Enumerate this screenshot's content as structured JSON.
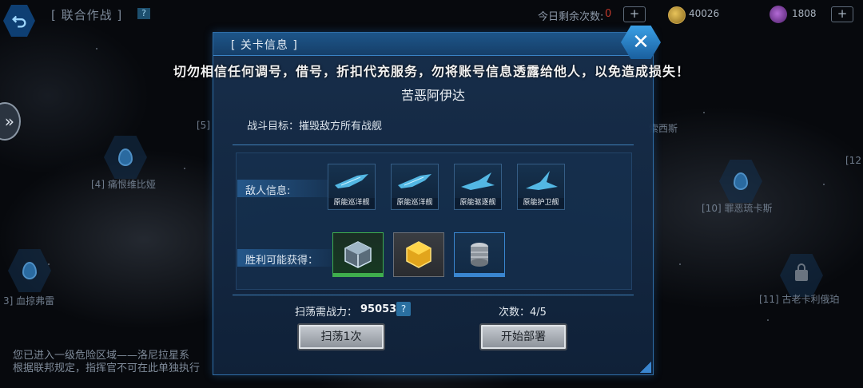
{
  "topbar": {
    "title": "[ 联合作战 ]",
    "help": "?",
    "remain_label": "今日剩余次数:",
    "remain_count": "0",
    "plus": "+",
    "coins": "40026",
    "gems": "1808"
  },
  "map": {
    "nodes": [
      {
        "label": "[4] 痛恨维比娅"
      },
      {
        "label": "3] 血掠弗雷"
      },
      {
        "label": "[5]"
      },
      {
        "label": "[10] 罪恶琉卡斯"
      },
      {
        "label": "[11] 古老卡利俄珀"
      },
      {
        "label": "[12"
      },
      {
        "label": "索西斯"
      }
    ],
    "notice_line1": "您已进入一级危险区域——洛尼拉星系",
    "notice_line2": "根据联邦规定，指挥官不可在此单独执行"
  },
  "warning": "切勿相信任何调号，借号，折扣代充服务，勿将账号信息透露给他人，以免造成损失！",
  "modal": {
    "title": "[ 关卡信息 ]",
    "level_name": "苦恶阿伊达",
    "objective": "战斗目标：摧毁敌方所有战舰",
    "enemy_label": "敌人信息:",
    "enemies": [
      {
        "name": "原能巡洋舰"
      },
      {
        "name": "原能巡洋舰"
      },
      {
        "name": "原能驱逐舰"
      },
      {
        "name": "原能护卫舰"
      }
    ],
    "reward_label": "胜利可能获得：",
    "sweep_power_label": "扫荡需战力：",
    "sweep_power_value": "95053",
    "help": "?",
    "count_label": "次数：4/5",
    "sweep_button": "扫荡1次",
    "deploy_button": "开始部署",
    "close": "✕"
  },
  "colors": {
    "accent": "#2f6ea8",
    "remain_red": "#c0392b",
    "reward_green": "#3fae4d",
    "reward_blue": "#3a86d0"
  }
}
